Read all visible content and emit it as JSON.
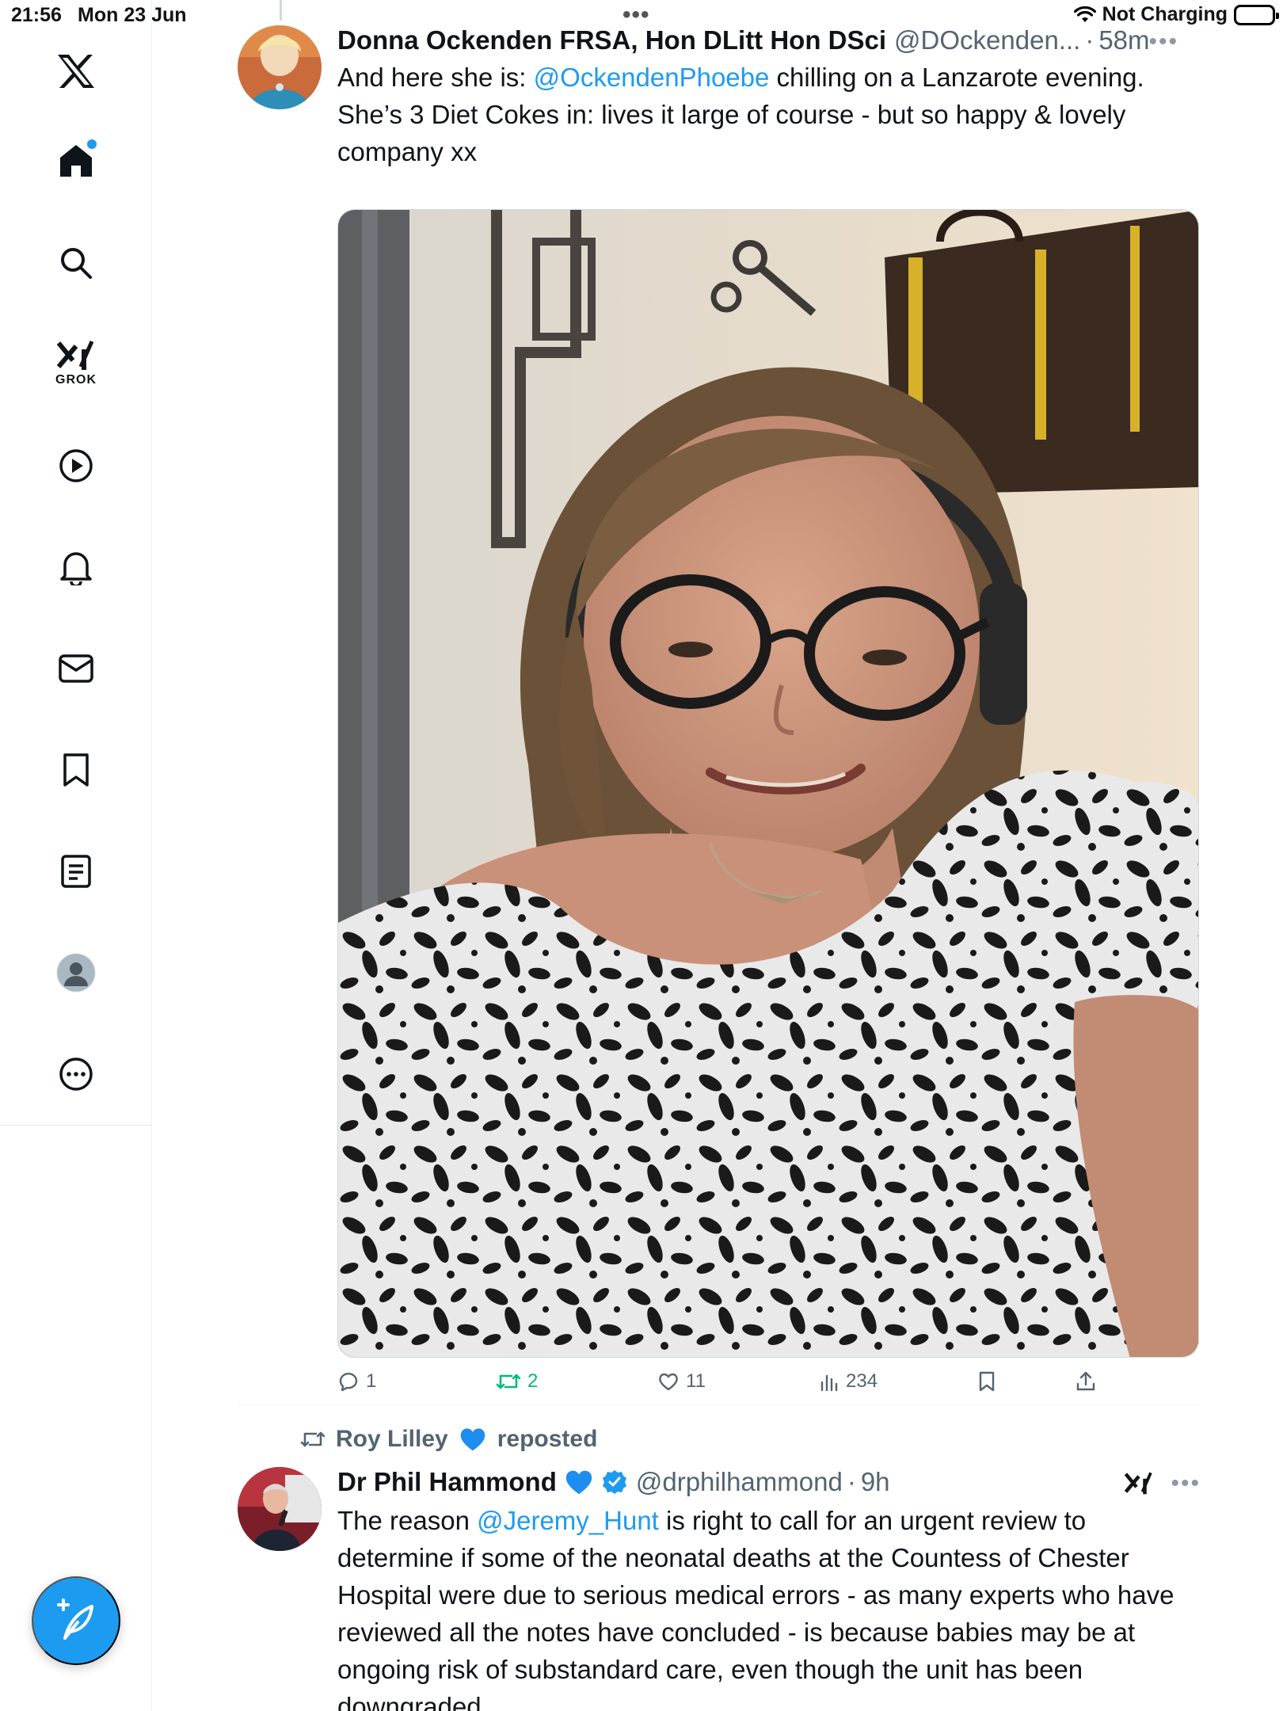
{
  "status_bar": {
    "time": "21:56",
    "date": "Mon 23 Jun",
    "battery_text": "Not Charging"
  },
  "sidebar": {
    "items": [
      {
        "name": "x-logo",
        "icon": "x-logo-icon"
      },
      {
        "name": "home",
        "icon": "home-icon"
      },
      {
        "name": "explore",
        "icon": "search-icon"
      },
      {
        "name": "grok",
        "icon": "grok-icon",
        "label": "GROK"
      },
      {
        "name": "video",
        "icon": "play-icon"
      },
      {
        "name": "notifications",
        "icon": "bell-icon"
      },
      {
        "name": "messages",
        "icon": "mail-icon"
      },
      {
        "name": "bookmarks",
        "icon": "bookmark-icon"
      },
      {
        "name": "lists",
        "icon": "list-icon"
      },
      {
        "name": "profile",
        "icon": "profile-avatar-icon"
      },
      {
        "name": "more",
        "icon": "more-circle-icon"
      }
    ],
    "compose_icon": "compose-feather-icon"
  },
  "tweets": [
    {
      "author_name": "Donna Ockenden FRSA, Hon DLitt Hon DSci",
      "handle": "@DOckenden...",
      "time": "58m",
      "text_mention": "@OckendenPhoebe",
      "text_pre": "And here she is: ",
      "text_post": " chilling on a Lanzarote evening. She’s 3 Diet  Cokes in: lives it large of course - but so  happy & lovely company xx",
      "actions": {
        "replies": "1",
        "retweets": "2",
        "likes": "11",
        "views": "234"
      }
    },
    {
      "repost_by": "Roy Lilley",
      "repost_label": "reposted",
      "author_name": "Dr Phil Hammond",
      "handle": "@drphilhammond",
      "time": "9h",
      "text_pre": "The reason ",
      "text_mention": "@Jeremy_Hunt",
      "text_post": " is right to call for an urgent review to determine if some of the neonatal deaths at the Countess of Chester Hospital were due to serious medical errors - as many experts who have reviewed all the notes have concluded - is because babies may be at ongoing risk of substandard care, even though the unit has been downgraded."
    }
  ],
  "colors": {
    "accent": "#1d9bf0",
    "retweet_green": "#00ba7c",
    "secondary_text": "#536471"
  }
}
